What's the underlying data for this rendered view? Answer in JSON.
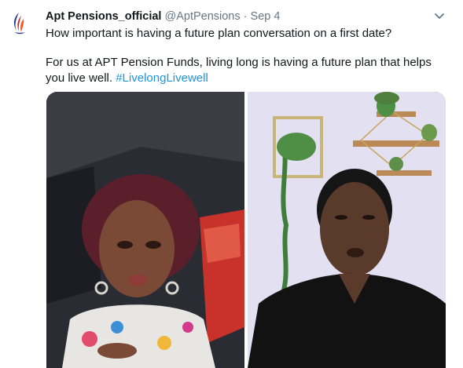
{
  "tweet": {
    "display_name": "Apt Pensions_official",
    "handle": "@AptPensions",
    "separator": "·",
    "date": "Sep 4",
    "text_line1": "How important is having a future plan conversation on a first date?",
    "text_line2": "For us at APT Pension Funds, living long is having a future plan that helps",
    "text_line3_prefix": "you live well.",
    "hashtag": "#LivelongLivewell"
  },
  "icons": {
    "avatar": "apt-flame-logo",
    "more": "chevron-down-icon"
  },
  "colors": {
    "link": "#1b95e0",
    "secondary_text": "#657786",
    "logo_blue": "#2b3990",
    "logo_orange": "#f15a24",
    "logo_red": "#c1272d"
  }
}
